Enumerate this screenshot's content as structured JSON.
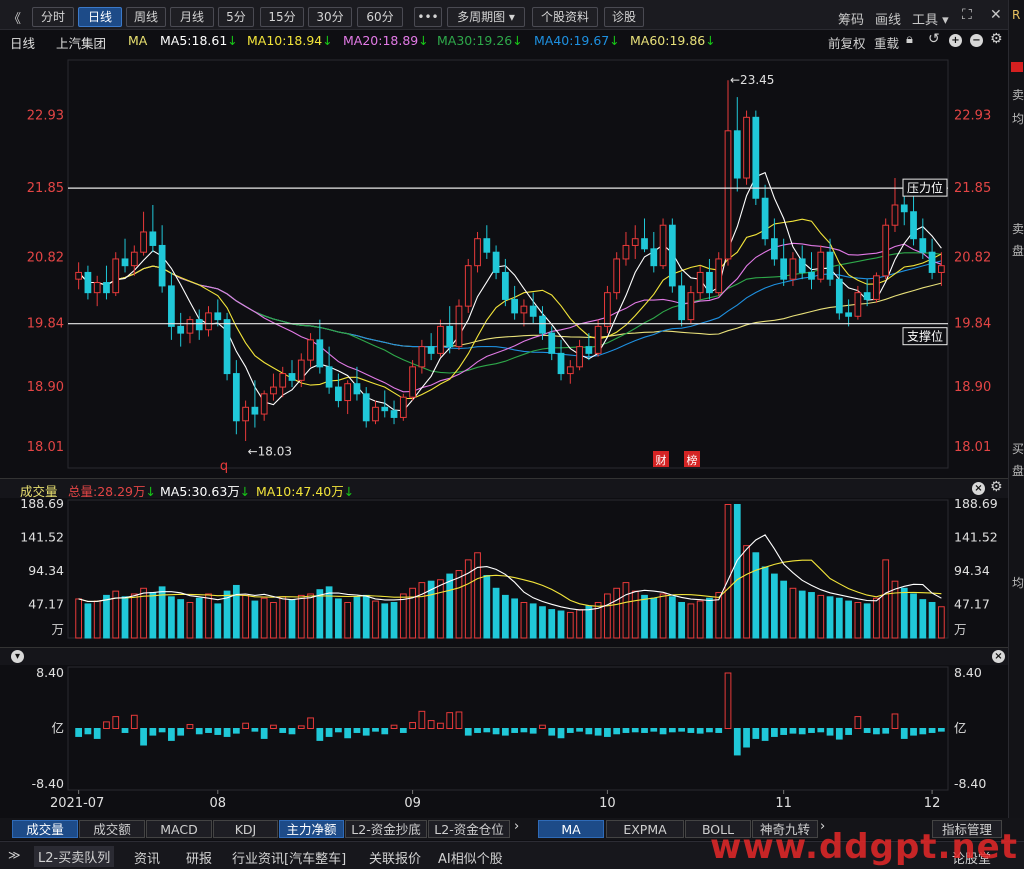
{
  "toolbar": {
    "collapse_glyph": "《",
    "periods": [
      "分时",
      "日线",
      "周线",
      "月线",
      "5分",
      "15分",
      "30分",
      "60分"
    ],
    "active_period": "日线",
    "more_glyph": "•••",
    "multi_period": "多周期图",
    "stock_info": "个股资料",
    "diagnose": "诊股",
    "chips": "筹码",
    "draw": "画线",
    "tools": "工具",
    "expand_icon": "expand-icon",
    "close_icon": "close-icon"
  },
  "header": {
    "period_label": "日线",
    "stock_name": "上汽集团",
    "indicator": "MA",
    "ma5": "MA5:18.61",
    "ma10": "MA10:18.94",
    "ma20": "MA20:18.89",
    "ma30": "MA30:19.26",
    "ma40": "MA40:19.67",
    "ma60": "MA60:19.86",
    "adjust": "前复权",
    "reset": "重载",
    "down_arrow": "↓"
  },
  "colors": {
    "up": "#e83a3a",
    "down": "#20c8d8",
    "ma5": "#ffffff",
    "ma10": "#f2e43a",
    "ma20": "#e27ae6",
    "ma30": "#2ea84a",
    "ma40": "#1e90e0",
    "ma60": "#e8e07a",
    "axis_text": "#e34545",
    "grid": "#2a2a30"
  },
  "price_axis": [
    "22.93",
    "21.85",
    "20.82",
    "19.84",
    "18.90",
    "18.01"
  ],
  "annotations": {
    "high": "←23.45",
    "low": "←18.03",
    "resistance": "压力位",
    "support": "支撑位",
    "marker_q": "q",
    "marker_cai": "财",
    "marker_bang": "榜"
  },
  "volume_panel": {
    "title": "成交量",
    "total": "总量:28.29万",
    "ma5": "MA5:30.63万",
    "ma10": "MA10:47.40万",
    "axis": [
      "188.69",
      "141.52",
      "94.34",
      "47.17",
      "万"
    ]
  },
  "flow_panel": {
    "axis": [
      "8.40",
      "亿",
      "-8.40"
    ]
  },
  "x_axis": [
    "2021-07",
    "08",
    "09",
    "10",
    "11",
    "12"
  ],
  "indicator_tabs": [
    "成交量",
    "成交额",
    "MACD",
    "KDJ",
    "主力净额",
    "L2-资金抄底",
    "L2-资金仓位"
  ],
  "active_indicator_tab": "主力净额",
  "first_indicator_tab": "成交量",
  "ma_tabs": [
    "MA",
    "EXPMA",
    "BOLL",
    "神奇九转"
  ],
  "active_ma_tab": "MA",
  "indicator_manage": "指标管理",
  "status_bar": [
    "L2-买卖队列",
    "资讯",
    "研报",
    "行业资讯[汽车整车]",
    "关联报价",
    "AI相似个股",
    "论股堂"
  ],
  "right_strip": [
    "R",
    "卖",
    "均",
    "卖",
    "盘",
    "买",
    "盘",
    "均"
  ],
  "watermark": "www.ddgpt.net",
  "chart_data": {
    "type": "candlestick",
    "title": "上汽集团 日线",
    "x": [
      "2021-07",
      "08",
      "09",
      "10",
      "11",
      "12"
    ],
    "ylim": [
      18.01,
      23.45
    ],
    "levels": {
      "resistance": 21.85,
      "support": 19.84
    },
    "extremes": {
      "high": 23.45,
      "low": 18.03
    },
    "ohlc": [
      [
        20.5,
        20.75,
        20.35,
        20.6
      ],
      [
        20.6,
        20.7,
        20.2,
        20.3
      ],
      [
        20.3,
        20.55,
        20.1,
        20.45
      ],
      [
        20.45,
        20.7,
        20.2,
        20.3
      ],
      [
        20.3,
        20.9,
        20.25,
        20.8
      ],
      [
        20.8,
        21.1,
        20.6,
        20.7
      ],
      [
        20.7,
        21.0,
        20.55,
        20.9
      ],
      [
        20.9,
        21.5,
        20.85,
        21.2
      ],
      [
        21.2,
        21.6,
        20.9,
        21.0
      ],
      [
        21.0,
        21.3,
        20.3,
        20.4
      ],
      [
        20.4,
        20.6,
        19.6,
        19.8
      ],
      [
        19.8,
        20.0,
        19.5,
        19.7
      ],
      [
        19.7,
        19.95,
        19.55,
        19.9
      ],
      [
        19.9,
        20.05,
        19.6,
        19.75
      ],
      [
        19.75,
        20.1,
        19.65,
        20.0
      ],
      [
        20.0,
        20.2,
        19.8,
        19.9
      ],
      [
        19.9,
        20.0,
        19.0,
        19.1
      ],
      [
        19.1,
        19.3,
        18.2,
        18.4
      ],
      [
        18.4,
        18.7,
        18.1,
        18.6
      ],
      [
        18.6,
        19.0,
        18.3,
        18.5
      ],
      [
        18.5,
        18.85,
        18.4,
        18.8
      ],
      [
        18.8,
        19.1,
        18.7,
        18.9
      ],
      [
        18.9,
        19.2,
        18.75,
        19.1
      ],
      [
        19.1,
        19.3,
        18.9,
        19.0
      ],
      [
        19.0,
        19.4,
        18.9,
        19.3
      ],
      [
        19.3,
        19.7,
        19.2,
        19.6
      ],
      [
        19.6,
        19.9,
        19.1,
        19.2
      ],
      [
        19.2,
        19.5,
        18.8,
        18.9
      ],
      [
        18.9,
        19.1,
        18.6,
        18.7
      ],
      [
        18.7,
        19.0,
        18.5,
        18.95
      ],
      [
        18.95,
        19.2,
        18.7,
        18.8
      ],
      [
        18.8,
        18.9,
        18.3,
        18.4
      ],
      [
        18.4,
        18.7,
        18.35,
        18.6
      ],
      [
        18.6,
        18.85,
        18.45,
        18.55
      ],
      [
        18.55,
        18.7,
        18.35,
        18.45
      ],
      [
        18.45,
        18.8,
        18.4,
        18.75
      ],
      [
        18.75,
        19.3,
        18.7,
        19.2
      ],
      [
        19.2,
        19.6,
        19.1,
        19.5
      ],
      [
        19.5,
        19.7,
        19.3,
        19.4
      ],
      [
        19.4,
        19.9,
        19.35,
        19.8
      ],
      [
        19.8,
        20.1,
        19.4,
        19.5
      ],
      [
        19.5,
        20.2,
        19.45,
        20.1
      ],
      [
        20.1,
        20.8,
        20.0,
        20.7
      ],
      [
        20.7,
        21.2,
        20.6,
        21.1
      ],
      [
        21.1,
        21.3,
        20.8,
        20.9
      ],
      [
        20.9,
        21.0,
        20.5,
        20.6
      ],
      [
        20.6,
        20.8,
        20.1,
        20.2
      ],
      [
        20.2,
        20.4,
        19.9,
        20.0
      ],
      [
        20.0,
        20.2,
        19.8,
        20.1
      ],
      [
        20.1,
        20.3,
        19.85,
        19.95
      ],
      [
        19.95,
        20.1,
        19.6,
        19.7
      ],
      [
        19.7,
        19.8,
        19.3,
        19.4
      ],
      [
        19.4,
        19.6,
        19.0,
        19.1
      ],
      [
        19.1,
        19.3,
        18.95,
        19.2
      ],
      [
        19.2,
        19.6,
        19.15,
        19.5
      ],
      [
        19.5,
        19.7,
        19.3,
        19.4
      ],
      [
        19.4,
        19.9,
        19.35,
        19.8
      ],
      [
        19.8,
        20.4,
        19.7,
        20.3
      ],
      [
        20.3,
        20.9,
        20.2,
        20.8
      ],
      [
        20.8,
        21.2,
        20.7,
        21.0
      ],
      [
        21.0,
        21.3,
        20.8,
        21.1
      ],
      [
        21.1,
        21.4,
        20.9,
        20.95
      ],
      [
        20.95,
        21.2,
        20.6,
        20.7
      ],
      [
        20.7,
        21.4,
        20.65,
        21.3
      ],
      [
        21.3,
        21.4,
        20.3,
        20.4
      ],
      [
        20.4,
        20.6,
        19.8,
        19.9
      ],
      [
        19.9,
        20.4,
        19.85,
        20.3
      ],
      [
        20.3,
        20.7,
        20.2,
        20.6
      ],
      [
        20.6,
        20.8,
        20.2,
        20.3
      ],
      [
        20.3,
        20.9,
        20.25,
        20.8
      ],
      [
        20.8,
        23.45,
        20.7,
        22.7
      ],
      [
        22.7,
        23.2,
        21.8,
        22.0
      ],
      [
        22.0,
        23.0,
        21.9,
        22.9
      ],
      [
        22.9,
        23.0,
        21.6,
        21.7
      ],
      [
        21.7,
        21.9,
        21.0,
        21.1
      ],
      [
        21.1,
        21.4,
        20.7,
        20.8
      ],
      [
        20.8,
        21.1,
        20.4,
        20.5
      ],
      [
        20.5,
        20.9,
        20.4,
        20.8
      ],
      [
        20.8,
        21.0,
        20.5,
        20.6
      ],
      [
        20.6,
        20.9,
        20.35,
        20.5
      ],
      [
        20.5,
        21.0,
        20.45,
        20.9
      ],
      [
        20.9,
        21.1,
        20.4,
        20.5
      ],
      [
        20.5,
        20.7,
        19.9,
        20.0
      ],
      [
        20.0,
        20.2,
        19.8,
        19.95
      ],
      [
        19.95,
        20.4,
        19.9,
        20.3
      ],
      [
        20.3,
        20.5,
        20.1,
        20.2
      ],
      [
        20.2,
        20.6,
        20.15,
        20.55
      ],
      [
        20.55,
        21.4,
        20.5,
        21.3
      ],
      [
        21.3,
        22.0,
        21.2,
        21.6
      ],
      [
        21.6,
        21.9,
        21.3,
        21.5
      ],
      [
        21.5,
        21.8,
        21.0,
        21.1
      ],
      [
        21.1,
        21.4,
        20.8,
        20.9
      ],
      [
        20.9,
        21.1,
        20.5,
        20.6
      ],
      [
        20.6,
        20.9,
        20.4,
        20.7
      ]
    ],
    "volume": [
      55,
      48,
      52,
      60,
      66,
      58,
      62,
      70,
      64,
      72,
      58,
      54,
      50,
      56,
      62,
      48,
      66,
      74,
      60,
      52,
      56,
      50,
      58,
      54,
      60,
      62,
      68,
      72,
      55,
      50,
      58,
      60,
      52,
      48,
      50,
      62,
      70,
      78,
      80,
      82,
      90,
      95,
      110,
      120,
      88,
      70,
      60,
      55,
      50,
      48,
      44,
      40,
      38,
      36,
      40,
      45,
      50,
      62,
      70,
      78,
      66,
      60,
      56,
      62,
      58,
      50,
      48,
      52,
      56,
      64,
      188,
      188,
      130,
      120,
      100,
      90,
      80,
      70,
      66,
      64,
      60,
      58,
      56,
      52,
      50,
      48,
      56,
      110,
      80,
      70,
      62,
      54,
      50,
      44
    ],
    "flow": [
      -1.2,
      -0.8,
      -1.5,
      1.0,
      1.8,
      -0.6,
      2.0,
      -2.5,
      -1.0,
      -0.5,
      -1.8,
      -1.0,
      0.6,
      -0.8,
      -0.6,
      -0.9,
      -1.2,
      -0.7,
      0.8,
      -0.4,
      -1.5,
      0.5,
      -0.6,
      -0.8,
      0.4,
      1.6,
      -1.8,
      -1.2,
      -0.5,
      -1.4,
      -0.6,
      -1.0,
      -0.4,
      -0.8,
      0.5,
      -0.6,
      0.9,
      2.6,
      1.2,
      0.8,
      2.4,
      2.5,
      -1.0,
      -0.6,
      -0.5,
      -0.8,
      -1.0,
      -0.6,
      -0.5,
      -0.7,
      0.5,
      -1.0,
      -1.4,
      -0.6,
      -0.4,
      -0.8,
      -1.0,
      -1.2,
      -0.8,
      -0.6,
      -0.5,
      -0.6,
      -0.4,
      -0.8,
      -0.5,
      -0.4,
      -0.6,
      -0.7,
      -0.5,
      -0.6,
      8.4,
      -4.0,
      -2.8,
      -1.5,
      -1.8,
      -1.2,
      -0.9,
      -0.7,
      -0.8,
      -0.6,
      -0.5,
      -1.0,
      -1.6,
      -0.9,
      1.8,
      -0.6,
      -0.8,
      -0.7,
      2.2,
      -1.5,
      -1.0,
      -0.8,
      -0.6,
      -0.4
    ],
    "vol_ylim": [
      0,
      188.69
    ],
    "flow_ylim": [
      -8.4,
      8.4
    ]
  }
}
